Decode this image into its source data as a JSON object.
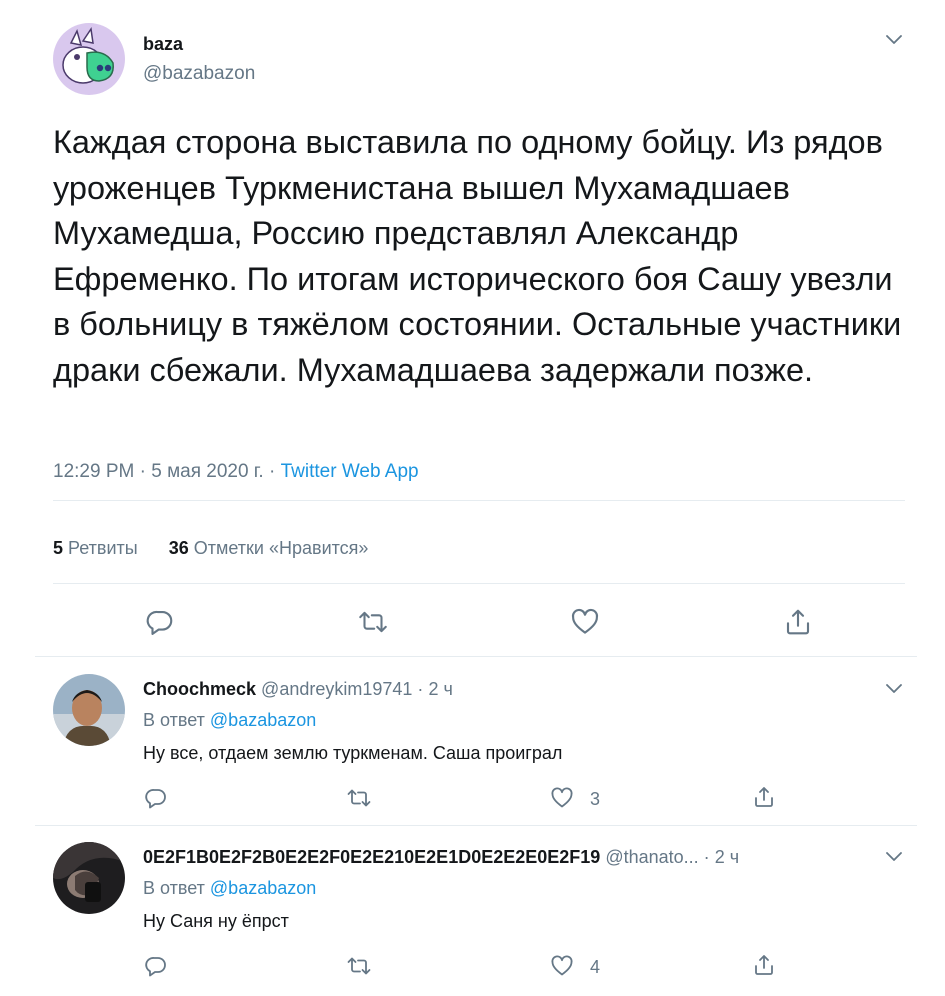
{
  "tweet": {
    "author_name": "baza",
    "author_handle": "@bazabazon",
    "text": "Каждая сторона выставила по одному бойцу. Из рядов уроженцев Туркменистана вышел Мухамадшаев Мухамедша, Россию представлял Александр Ефременко. По итогам исторического боя Сашу увезли в больницу в тяжёлом состоянии. Остальные участники драки сбежали. Мухамадшаева задержали позже.",
    "time": "12:29 PM",
    "sep": "·",
    "date": "5 мая 2020 г.",
    "source": "Twitter Web App",
    "retweets_count": "5",
    "retweets_label": "Ретвиты",
    "likes_count": "36",
    "likes_label": "Отметки «Нравится»"
  },
  "replies": [
    {
      "name": "Choochmeck",
      "handle": "@andreykim19741",
      "dot": "·",
      "time": "2 ч",
      "reply_to_label": "В ответ",
      "reply_to_handle": "@bazabazon",
      "text": "Ну все, отдаем землю туркменам. Саша проиграл",
      "likes": "3"
    },
    {
      "name": "0E2F1B0E2F2B0E2E2F0E2E210E2E1D0E2E2E0E2F19",
      "handle": "@thanato...",
      "dot": "·",
      "time": "2 ч",
      "reply_to_label": "В ответ",
      "reply_to_handle": "@bazabazon",
      "text": "Ну Саня ну ёпрст",
      "likes": "4"
    }
  ],
  "colors": {
    "accent": "#1b95e0",
    "muted": "#657786",
    "border": "#e6ecf0",
    "avatar_main_bg": "#d9c8ee",
    "avatar_main_face": "#3fd191"
  }
}
